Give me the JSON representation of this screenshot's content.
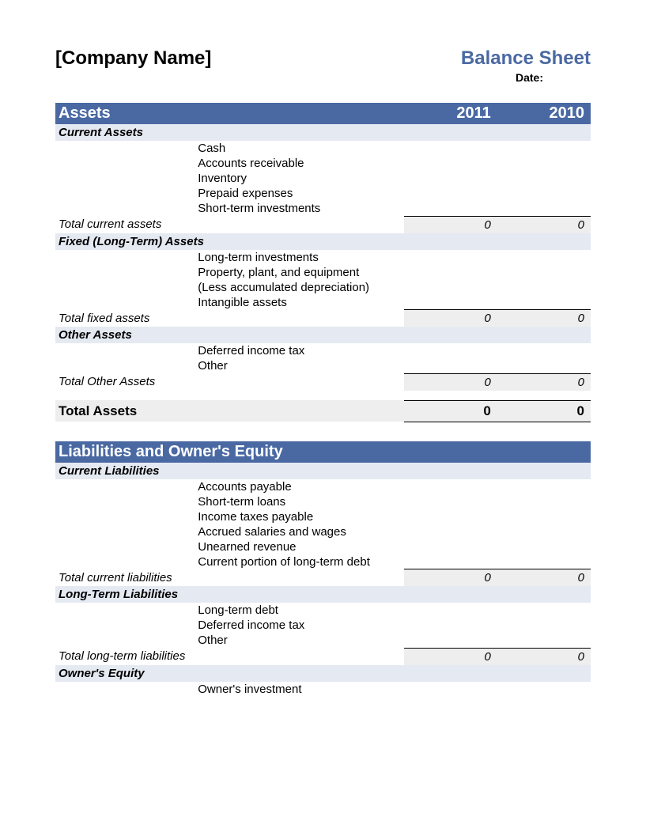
{
  "header": {
    "company": "[Company Name]",
    "title": "Balance Sheet",
    "date_label": "Date:"
  },
  "years": {
    "y1": "2011",
    "y2": "2010"
  },
  "assets": {
    "title": "Assets",
    "current": {
      "title": "Current Assets",
      "items": [
        "Cash",
        "Accounts receivable",
        "Inventory",
        "Prepaid expenses",
        "Short-term investments"
      ],
      "total_label": "Total current assets",
      "total_y1": "0",
      "total_y2": "0"
    },
    "fixed": {
      "title": "Fixed (Long-Term) Assets",
      "items": [
        "Long-term investments",
        "Property, plant, and equipment",
        "(Less accumulated depreciation)",
        "Intangible assets"
      ],
      "total_label": "Total fixed assets",
      "total_y1": "0",
      "total_y2": "0"
    },
    "other": {
      "title": "Other Assets",
      "items": [
        "Deferred income tax",
        "Other"
      ],
      "total_label": "Total Other Assets",
      "total_y1": "0",
      "total_y2": "0"
    },
    "grand_total_label": "Total Assets",
    "grand_total_y1": "0",
    "grand_total_y2": "0"
  },
  "liab": {
    "title": "Liabilities and Owner's Equity",
    "current": {
      "title": "Current Liabilities",
      "items": [
        "Accounts payable",
        "Short-term loans",
        "Income taxes payable",
        "Accrued salaries and wages",
        "Unearned revenue",
        "Current portion of long-term debt"
      ],
      "total_label": "Total current liabilities",
      "total_y1": "0",
      "total_y2": "0"
    },
    "longterm": {
      "title": "Long-Term Liabilities",
      "items": [
        "Long-term debt",
        "Deferred income tax",
        "Other"
      ],
      "total_label": "Total long-term liabilities",
      "total_y1": "0",
      "total_y2": "0"
    },
    "equity": {
      "title": "Owner's Equity",
      "items": [
        "Owner's investment"
      ]
    }
  }
}
